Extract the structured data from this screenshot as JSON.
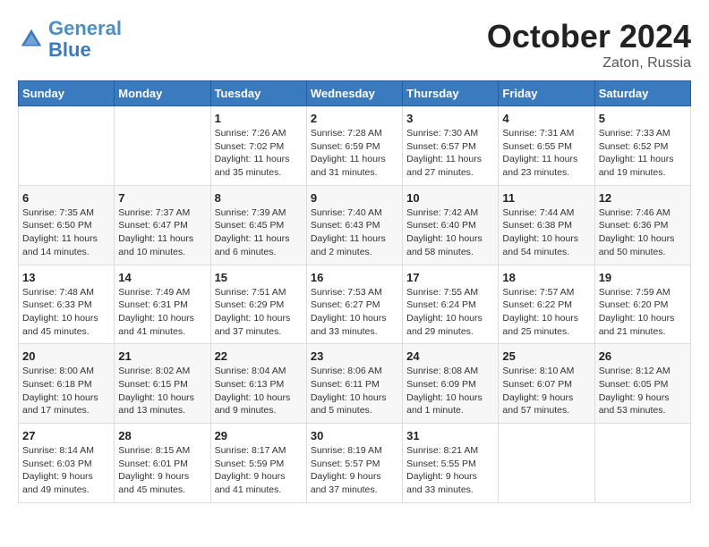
{
  "header": {
    "logo_line1": "General",
    "logo_line2": "Blue",
    "month": "October 2024",
    "location": "Zaton, Russia"
  },
  "weekdays": [
    "Sunday",
    "Monday",
    "Tuesday",
    "Wednesday",
    "Thursday",
    "Friday",
    "Saturday"
  ],
  "weeks": [
    [
      {
        "day": "",
        "info": ""
      },
      {
        "day": "",
        "info": ""
      },
      {
        "day": "1",
        "info": "Sunrise: 7:26 AM\nSunset: 7:02 PM\nDaylight: 11 hours and 35 minutes."
      },
      {
        "day": "2",
        "info": "Sunrise: 7:28 AM\nSunset: 6:59 PM\nDaylight: 11 hours and 31 minutes."
      },
      {
        "day": "3",
        "info": "Sunrise: 7:30 AM\nSunset: 6:57 PM\nDaylight: 11 hours and 27 minutes."
      },
      {
        "day": "4",
        "info": "Sunrise: 7:31 AM\nSunset: 6:55 PM\nDaylight: 11 hours and 23 minutes."
      },
      {
        "day": "5",
        "info": "Sunrise: 7:33 AM\nSunset: 6:52 PM\nDaylight: 11 hours and 19 minutes."
      }
    ],
    [
      {
        "day": "6",
        "info": "Sunrise: 7:35 AM\nSunset: 6:50 PM\nDaylight: 11 hours and 14 minutes."
      },
      {
        "day": "7",
        "info": "Sunrise: 7:37 AM\nSunset: 6:47 PM\nDaylight: 11 hours and 10 minutes."
      },
      {
        "day": "8",
        "info": "Sunrise: 7:39 AM\nSunset: 6:45 PM\nDaylight: 11 hours and 6 minutes."
      },
      {
        "day": "9",
        "info": "Sunrise: 7:40 AM\nSunset: 6:43 PM\nDaylight: 11 hours and 2 minutes."
      },
      {
        "day": "10",
        "info": "Sunrise: 7:42 AM\nSunset: 6:40 PM\nDaylight: 10 hours and 58 minutes."
      },
      {
        "day": "11",
        "info": "Sunrise: 7:44 AM\nSunset: 6:38 PM\nDaylight: 10 hours and 54 minutes."
      },
      {
        "day": "12",
        "info": "Sunrise: 7:46 AM\nSunset: 6:36 PM\nDaylight: 10 hours and 50 minutes."
      }
    ],
    [
      {
        "day": "13",
        "info": "Sunrise: 7:48 AM\nSunset: 6:33 PM\nDaylight: 10 hours and 45 minutes."
      },
      {
        "day": "14",
        "info": "Sunrise: 7:49 AM\nSunset: 6:31 PM\nDaylight: 10 hours and 41 minutes."
      },
      {
        "day": "15",
        "info": "Sunrise: 7:51 AM\nSunset: 6:29 PM\nDaylight: 10 hours and 37 minutes."
      },
      {
        "day": "16",
        "info": "Sunrise: 7:53 AM\nSunset: 6:27 PM\nDaylight: 10 hours and 33 minutes."
      },
      {
        "day": "17",
        "info": "Sunrise: 7:55 AM\nSunset: 6:24 PM\nDaylight: 10 hours and 29 minutes."
      },
      {
        "day": "18",
        "info": "Sunrise: 7:57 AM\nSunset: 6:22 PM\nDaylight: 10 hours and 25 minutes."
      },
      {
        "day": "19",
        "info": "Sunrise: 7:59 AM\nSunset: 6:20 PM\nDaylight: 10 hours and 21 minutes."
      }
    ],
    [
      {
        "day": "20",
        "info": "Sunrise: 8:00 AM\nSunset: 6:18 PM\nDaylight: 10 hours and 17 minutes."
      },
      {
        "day": "21",
        "info": "Sunrise: 8:02 AM\nSunset: 6:15 PM\nDaylight: 10 hours and 13 minutes."
      },
      {
        "day": "22",
        "info": "Sunrise: 8:04 AM\nSunset: 6:13 PM\nDaylight: 10 hours and 9 minutes."
      },
      {
        "day": "23",
        "info": "Sunrise: 8:06 AM\nSunset: 6:11 PM\nDaylight: 10 hours and 5 minutes."
      },
      {
        "day": "24",
        "info": "Sunrise: 8:08 AM\nSunset: 6:09 PM\nDaylight: 10 hours and 1 minute."
      },
      {
        "day": "25",
        "info": "Sunrise: 8:10 AM\nSunset: 6:07 PM\nDaylight: 9 hours and 57 minutes."
      },
      {
        "day": "26",
        "info": "Sunrise: 8:12 AM\nSunset: 6:05 PM\nDaylight: 9 hours and 53 minutes."
      }
    ],
    [
      {
        "day": "27",
        "info": "Sunrise: 8:14 AM\nSunset: 6:03 PM\nDaylight: 9 hours and 49 minutes."
      },
      {
        "day": "28",
        "info": "Sunrise: 8:15 AM\nSunset: 6:01 PM\nDaylight: 9 hours and 45 minutes."
      },
      {
        "day": "29",
        "info": "Sunrise: 8:17 AM\nSunset: 5:59 PM\nDaylight: 9 hours and 41 minutes."
      },
      {
        "day": "30",
        "info": "Sunrise: 8:19 AM\nSunset: 5:57 PM\nDaylight: 9 hours and 37 minutes."
      },
      {
        "day": "31",
        "info": "Sunrise: 8:21 AM\nSunset: 5:55 PM\nDaylight: 9 hours and 33 minutes."
      },
      {
        "day": "",
        "info": ""
      },
      {
        "day": "",
        "info": ""
      }
    ]
  ]
}
